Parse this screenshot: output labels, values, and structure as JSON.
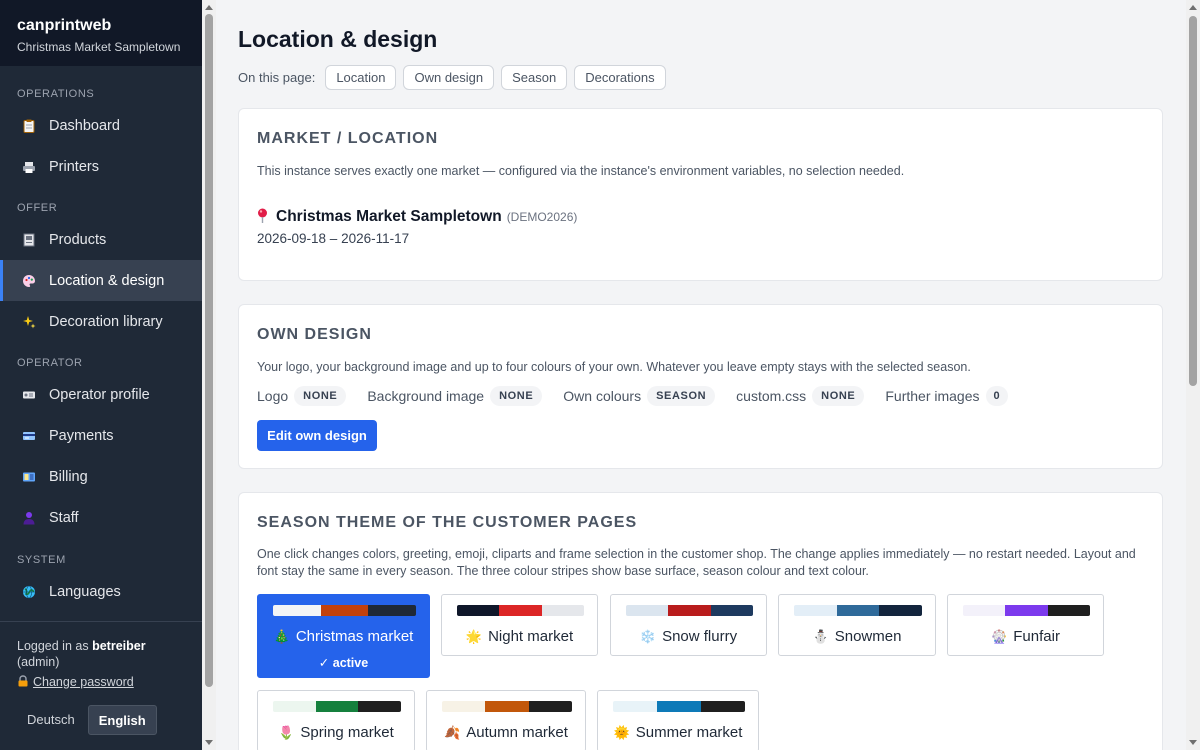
{
  "brand": {
    "name": "canprintweb",
    "subtitle": "Christmas Market Sampletown"
  },
  "sidebar": {
    "sections": {
      "operations": "OPERATIONS",
      "offer": "OFFER",
      "operator": "OPERATOR",
      "system": "SYSTEM"
    },
    "items": [
      {
        "label": "Dashboard",
        "icon": "clipboard-icon"
      },
      {
        "label": "Printers",
        "icon": "printer-icon"
      },
      {
        "label": "Products",
        "icon": "product-icon"
      },
      {
        "label": "Location & design",
        "icon": "palette-icon",
        "active": true
      },
      {
        "label": "Decoration library",
        "icon": "sparkles-icon"
      },
      {
        "label": "Operator profile",
        "icon": "id-card-icon"
      },
      {
        "label": "Payments",
        "icon": "credit-card-icon"
      },
      {
        "label": "Billing",
        "icon": "receipt-icon"
      },
      {
        "label": "Staff",
        "icon": "person-icon"
      },
      {
        "label": "Languages",
        "icon": "globe-icon"
      }
    ],
    "user": {
      "prefix": "Logged in as",
      "name": "betreiber",
      "role": "(admin)",
      "change_password": "Change password"
    },
    "languages": [
      "Deutsch",
      "English"
    ],
    "active_language": "English"
  },
  "page": {
    "title": "Location & design",
    "on_this_page_label": "On this page:",
    "anchors": [
      "Location",
      "Own design",
      "Season",
      "Decorations"
    ]
  },
  "location": {
    "heading": "MARKET / LOCATION",
    "description": "This instance serves exactly one market — configured via the instance's environment variables, no selection needed.",
    "market_name": "Christmas Market Sampletown",
    "market_code": "(DEMO2026)",
    "dates": "2026-09-18 – 2026-11-17"
  },
  "own_design": {
    "heading": "OWN DESIGN",
    "description": "Your logo, your background image and up to four colours of your own. Whatever you leave empty stays with the selected season.",
    "status": [
      {
        "label": "Logo",
        "value": "NONE"
      },
      {
        "label": "Background image",
        "value": "NONE"
      },
      {
        "label": "Own colours",
        "value": "SEASON"
      },
      {
        "label": "custom.css",
        "value": "NONE"
      },
      {
        "label": "Further images",
        "value": "0"
      }
    ],
    "edit_button": "Edit own design"
  },
  "season": {
    "heading": "SEASON THEME OF THE CUSTOMER PAGES",
    "description": "One click changes colors, greeting, emoji, cliparts and frame selection in the customer shop. The change applies immediately — no restart needed. Layout and font stay the same in every season. The three colour stripes show base surface, season colour and text colour.",
    "active_label": "✓ active",
    "themes": [
      {
        "label": "Christmas market",
        "emoji": "🎄",
        "colors": [
          "#f3f4f6",
          "#c2410c",
          "#1f2937"
        ],
        "active": true
      },
      {
        "label": "Night market",
        "emoji": "🌟",
        "colors": [
          "#0f172a",
          "#dc2626",
          "#e5e7eb"
        ]
      },
      {
        "label": "Snow flurry",
        "emoji": "❄️",
        "colors": [
          "#dbe5ef",
          "#b91c1c",
          "#1e3a5f"
        ]
      },
      {
        "label": "Snowmen",
        "emoji": "⛄",
        "colors": [
          "#e3eef7",
          "#2f6a9a",
          "#13253d"
        ]
      },
      {
        "label": "Funfair",
        "emoji": "🎡",
        "colors": [
          "#f3f1fa",
          "#7c3aed",
          "#1f1f1f"
        ]
      },
      {
        "label": "Spring market",
        "emoji": "🌷",
        "colors": [
          "#ecf6ef",
          "#15803d",
          "#1f1f1f"
        ]
      },
      {
        "label": "Autumn market",
        "emoji": "🍂",
        "colors": [
          "#f7f2e6",
          "#c2570a",
          "#1f1f1f"
        ]
      },
      {
        "label": "Summer market",
        "emoji": "🌞",
        "colors": [
          "#e8f3f8",
          "#0e7ab8",
          "#1f1f1f"
        ]
      }
    ]
  }
}
